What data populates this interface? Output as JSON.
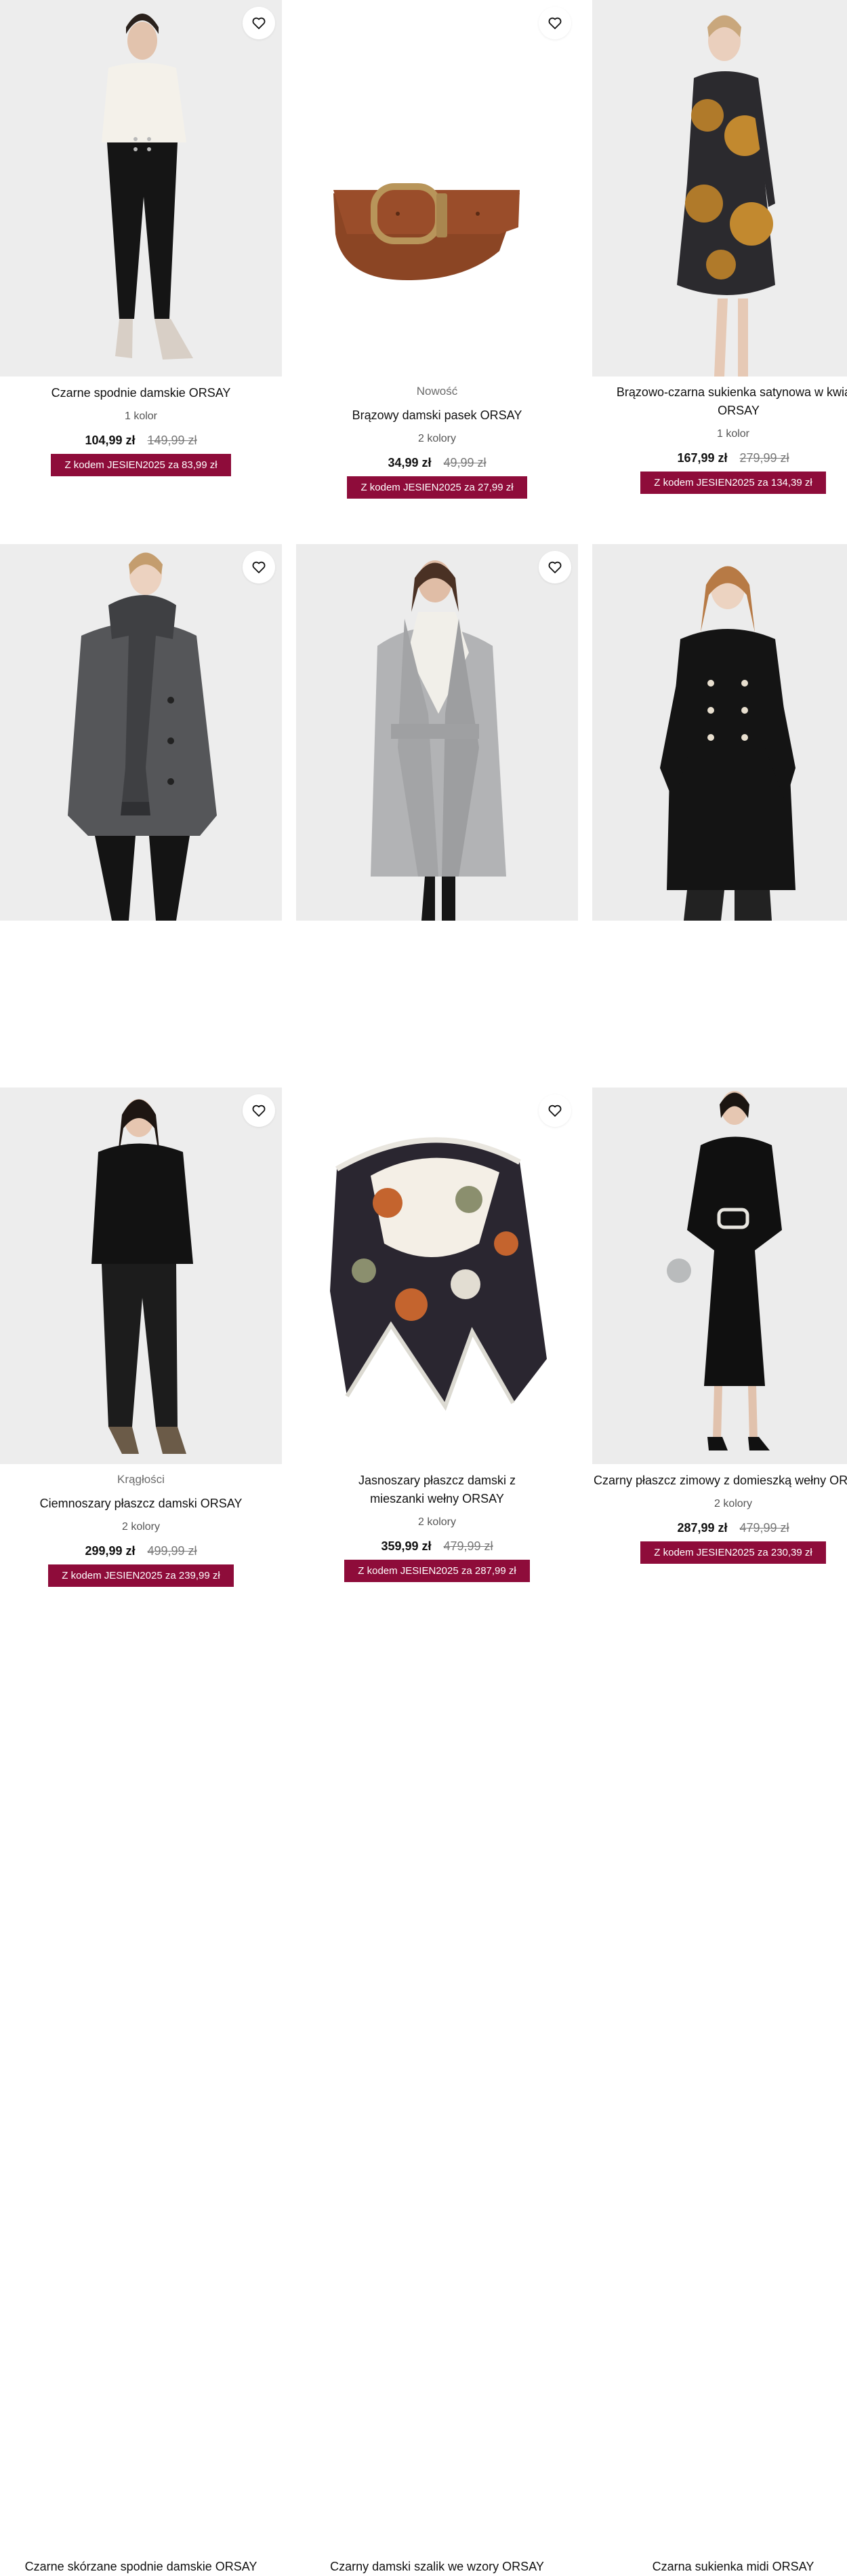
{
  "accent_color": "#8e0c3a",
  "icons": {
    "favorite": "heart-outline-icon"
  },
  "products": [
    {
      "badge": "",
      "name": "Czarne spodnie damskie ORSAY",
      "colors": "1 kolor",
      "price": "104,99 zł",
      "old_price": "149,99 zł",
      "promo": "Z kodem JESIEN2025 za 83,99 zł"
    },
    {
      "badge": "Nowość",
      "name": "Brązowy damski pasek ORSAY",
      "colors": "2 kolory",
      "price": "34,99 zł",
      "old_price": "49,99 zł",
      "promo": "Z kodem JESIEN2025 za 27,99 zł"
    },
    {
      "badge": "",
      "name": "Brązowo-czarna sukienka satynowa w kwiaty ORSAY",
      "colors": "1 kolor",
      "price": "167,99 zł",
      "old_price": "279,99 zł",
      "promo": "Z kodem JESIEN2025 za 134,39 zł"
    },
    {
      "badge": "Krągłości",
      "name": "Ciemnoszary płaszcz damski ORSAY",
      "colors": "2 kolory",
      "price": "299,99 zł",
      "old_price": "499,99 zł",
      "promo": "Z kodem JESIEN2025 za 239,99 zł"
    },
    {
      "badge": "",
      "name": "Jasnoszary płaszcz damski z mieszanki wełny ORSAY",
      "colors": "2 kolory",
      "price": "359,99 zł",
      "old_price": "479,99 zł",
      "promo": "Z kodem JESIEN2025 za 287,99 zł"
    },
    {
      "badge": "",
      "name": "Czarny płaszcz zimowy z domieszką wełny ORSAY",
      "colors": "2 kolory",
      "price": "287,99 zł",
      "old_price": "479,99 zł",
      "promo": "Z kodem JESIEN2025 za 230,39 zł"
    },
    {
      "badge": "",
      "name": "Czarne skórzane spodnie damskie ORSAY"
    },
    {
      "badge": "",
      "name": "Czarny damski szalik we wzory ORSAY"
    },
    {
      "badge": "",
      "name": "Czarna sukienka midi ORSAY"
    }
  ]
}
